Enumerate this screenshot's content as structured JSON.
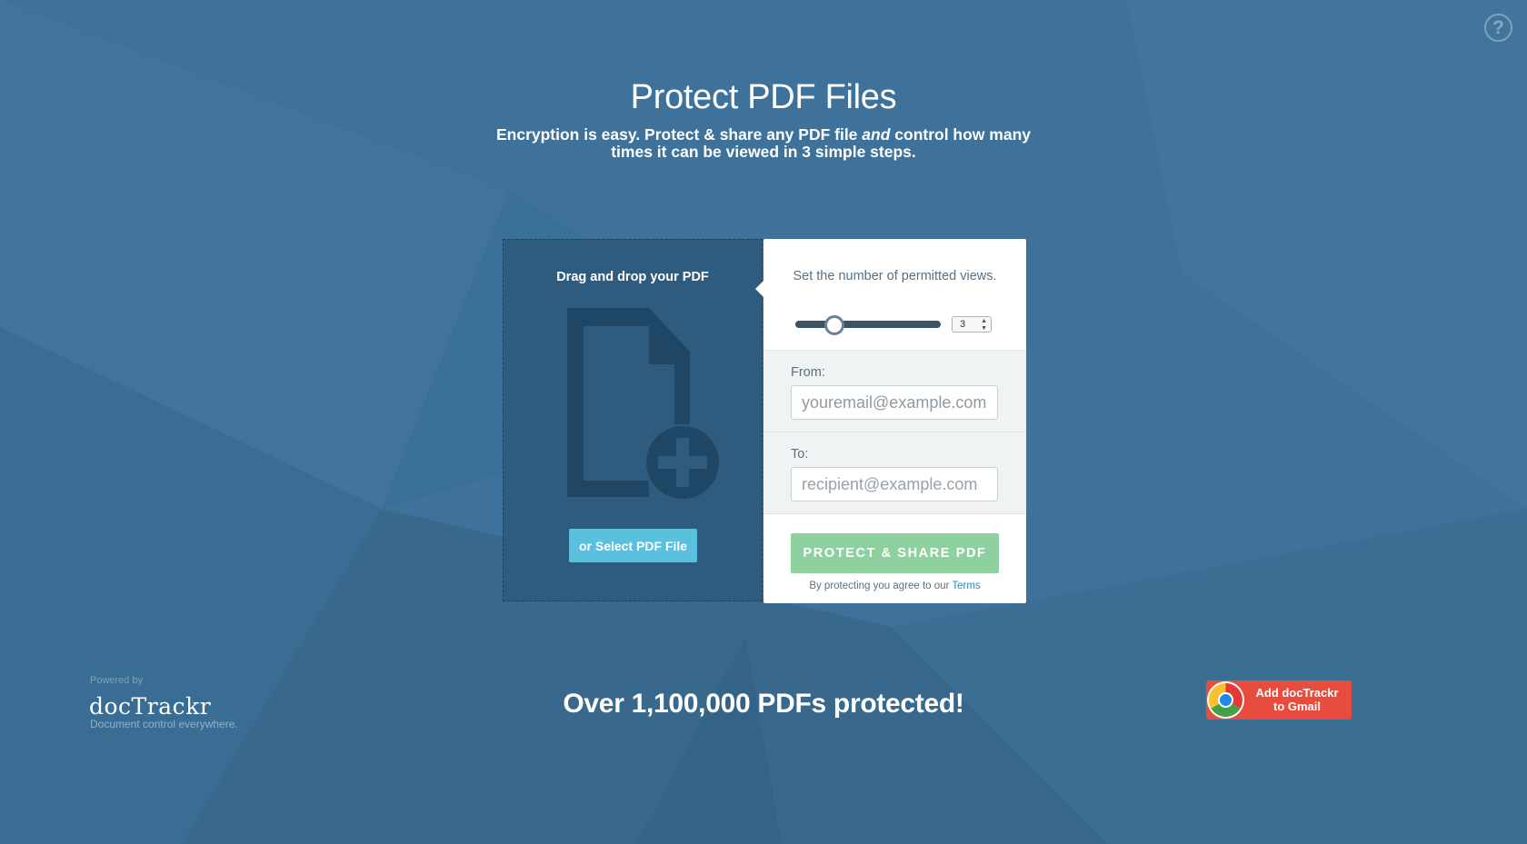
{
  "page": {
    "title": "Protect PDF Files",
    "subtitle_part1": "Encryption is easy. Protect & share any PDF file ",
    "subtitle_emphasis": "and",
    "subtitle_part2": " control how many times it can be viewed in 3 simple steps."
  },
  "help": {
    "icon": "question-circle-icon",
    "label": "?"
  },
  "dropzone": {
    "label": "Drag and drop your PDF",
    "icon": "pdf-add-icon",
    "select_button": "or Select PDF File"
  },
  "views": {
    "label": "Set the number of permitted views.",
    "value": "3",
    "slider_fraction": 0.26
  },
  "from": {
    "label": "From:",
    "placeholder": "youremail@example.com",
    "value": ""
  },
  "to": {
    "label": "To:",
    "placeholder": "recipient@example.com",
    "value": ""
  },
  "submit": {
    "button": "PROTECT & SHARE PDF",
    "terms_prefix": "By protecting you agree to our ",
    "terms_link": "Terms"
  },
  "brand": {
    "powered_by": "Powered by",
    "name": "docTrackr",
    "tagline": "Document control everywhere."
  },
  "counter": "Over 1,100,000 PDFs protected!",
  "gmail": {
    "icon": "chrome-icon",
    "line1": "Add docTrackr",
    "line2": "to Gmail"
  },
  "colors": {
    "background": "#3e729a",
    "dropzone": "#2f5c7e",
    "select_button": "#5bc0de",
    "protect_button": "#8fd19e",
    "gmail_button": "#e84c3d",
    "link": "#2f86b6"
  }
}
